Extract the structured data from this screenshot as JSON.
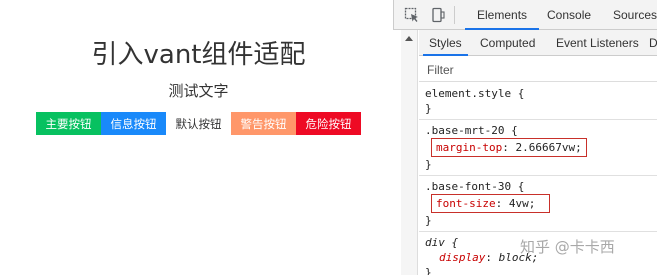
{
  "page": {
    "title": "引入vant组件适配",
    "subtitle": "测试文字",
    "buttons": [
      {
        "label": "主要按钮",
        "type": "primary"
      },
      {
        "label": "信息按钮",
        "type": "info"
      },
      {
        "label": "默认按钮",
        "type": "default"
      },
      {
        "label": "警告按钮",
        "type": "warning"
      },
      {
        "label": "危险按钮",
        "type": "danger"
      }
    ]
  },
  "devtools": {
    "tabs": [
      "Elements",
      "Console",
      "Sources"
    ],
    "active_tab": "Elements",
    "subtabs": [
      "Styles",
      "Computed",
      "Event Listeners",
      "D"
    ],
    "active_subtab": "Styles",
    "filter_placeholder": "Filter",
    "rules": [
      {
        "selector": "element.style {",
        "decls": [],
        "close": "}"
      },
      {
        "selector": ".base-mrt-20 {",
        "decls": [
          {
            "prop": "margin-top",
            "value": "2.66667vw;"
          }
        ],
        "close": "}"
      },
      {
        "selector": ".base-font-30 {",
        "decls": [
          {
            "prop": "font-size",
            "value": "4vw;"
          }
        ],
        "close": "}"
      },
      {
        "selector": "div {",
        "decls": [
          {
            "prop": "display",
            "value": "block;"
          }
        ],
        "close": "}"
      }
    ]
  },
  "watermark": "知乎 @卡卡西",
  "colors": {
    "primary": "#07c160",
    "info": "#1989fa",
    "warning": "#ff976a",
    "danger": "#ee0a24",
    "accent": "#1a73e8"
  }
}
